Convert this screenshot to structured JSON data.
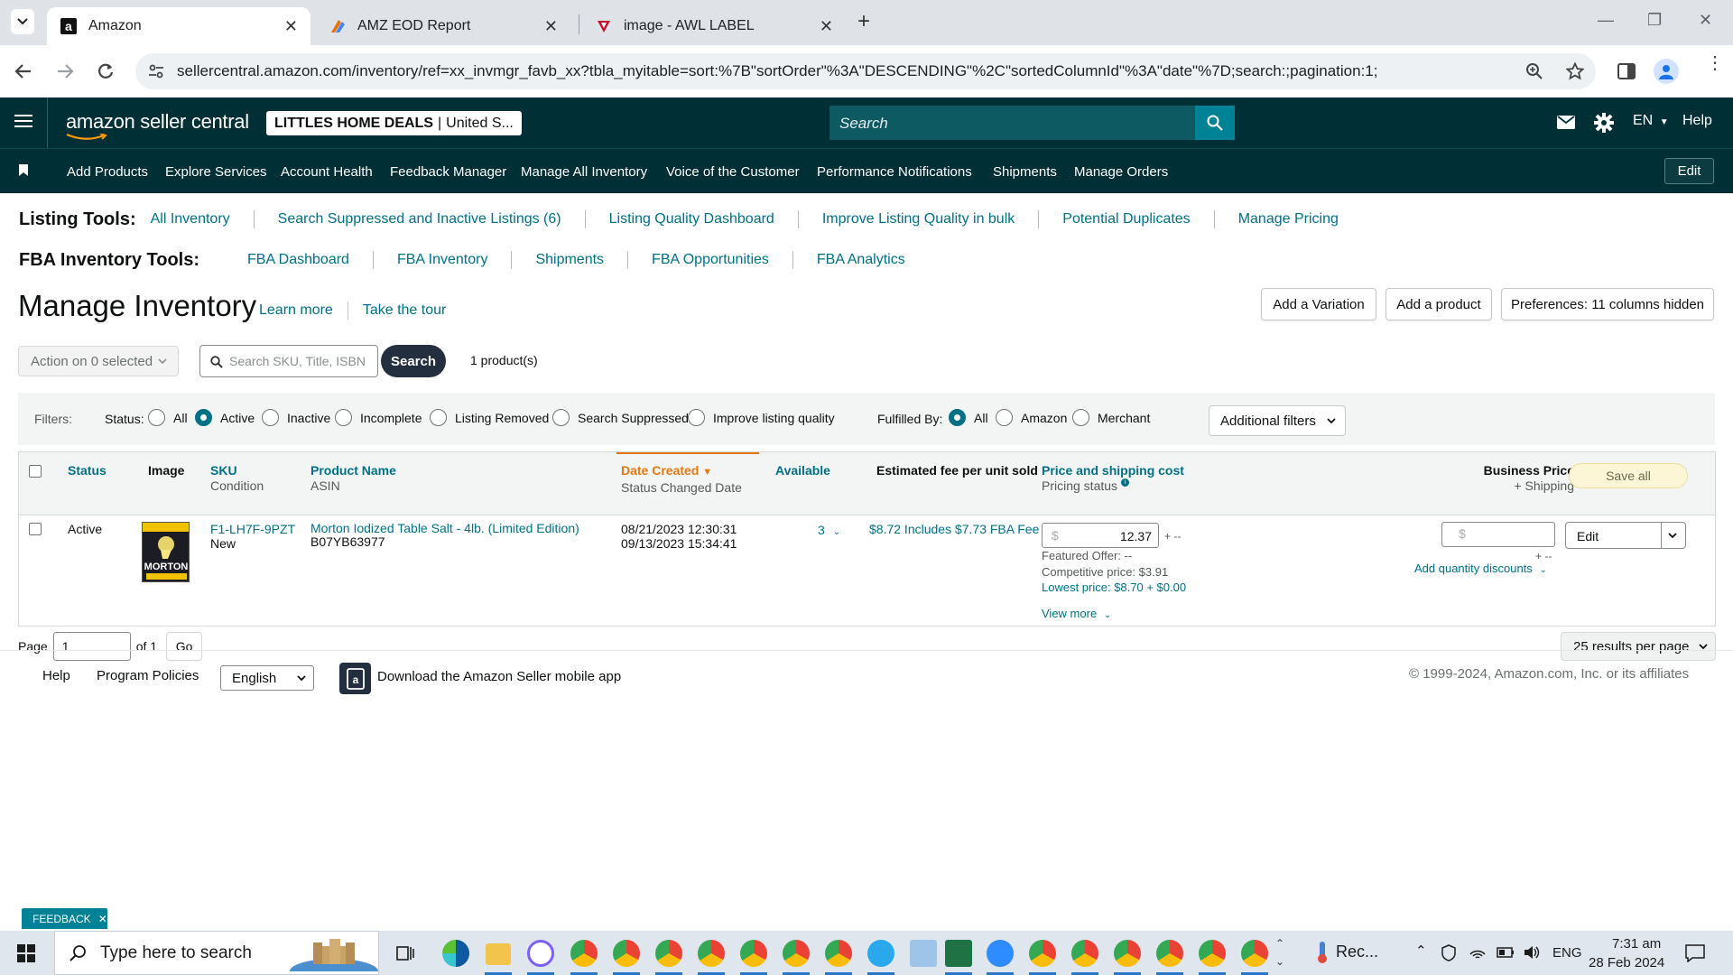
{
  "browser": {
    "tabs": [
      {
        "title": "Amazon",
        "active": true
      },
      {
        "title": "AMZ EOD Report",
        "active": false
      },
      {
        "title": "image - AWL LABEL",
        "active": false
      }
    ],
    "url": "sellercentral.amazon.com/inventory/ref=xx_invmgr_favb_xx?tbla_myitable=sort:%7B\"sortOrder\"%3A\"DESCENDING\"%2C\"sortedColumnId\"%3A\"date\"%7D;search:;pagination:1;"
  },
  "header": {
    "logo": "amazon seller central",
    "store_name": "LITTLES HOME DEALS",
    "store_region": "United S...",
    "search_placeholder": "Search",
    "language": "EN",
    "help": "Help"
  },
  "nav": {
    "items": [
      "Add Products",
      "Explore Services",
      "Account Health",
      "Feedback Manager",
      "Manage All Inventory",
      "Voice of the Customer",
      "Performance Notifications",
      "Shipments",
      "Manage Orders"
    ],
    "edit": "Edit"
  },
  "listing_tools": {
    "title": "Listing Tools:",
    "links": [
      "All Inventory",
      "Search Suppressed and Inactive Listings (6)",
      "Listing Quality Dashboard",
      "Improve Listing Quality in bulk",
      "Potential Duplicates",
      "Manage Pricing"
    ]
  },
  "fba_tools": {
    "title": "FBA Inventory Tools:",
    "links": [
      "FBA Dashboard",
      "FBA Inventory",
      "Shipments",
      "FBA Opportunities",
      "FBA Analytics"
    ]
  },
  "page": {
    "title": "Manage Inventory",
    "learn_more": "Learn more",
    "tour": "Take the tour",
    "add_variation": "Add a Variation",
    "add_product": "Add a product",
    "preferences": "Preferences: 11 columns hidden"
  },
  "actions": {
    "action_select": "Action on 0 selected",
    "search_placeholder": "Search SKU, Title, ISBN",
    "search_btn": "Search",
    "count": "1 product(s)"
  },
  "filters": {
    "label": "Filters:",
    "status_label": "Status:",
    "status_options": [
      "All",
      "Active",
      "Inactive",
      "Incomplete",
      "Listing Removed",
      "Search Suppressed",
      "Improve listing quality"
    ],
    "status_selected": "Active",
    "fulfilled_label": "Fulfilled By:",
    "fulfilled_options": [
      "All",
      "Amazon",
      "Merchant"
    ],
    "fulfilled_selected": "All",
    "additional": "Additional filters"
  },
  "table": {
    "headers": {
      "status": "Status",
      "image": "Image",
      "sku": "SKU",
      "condition": "Condition",
      "product_name": "Product Name",
      "asin": "ASIN",
      "date_created": "Date Created",
      "status_changed": "Status Changed Date",
      "available": "Available",
      "fee": "Estimated fee per unit sold",
      "price": "Price and shipping cost",
      "pricing_status": "Pricing status",
      "business_price": "Business Price",
      "plus_shipping": "+ Shipping",
      "save_all": "Save all"
    },
    "rows": [
      {
        "status": "Active",
        "image_text": "MORTON",
        "sku": "F1-LH7F-9PZT",
        "condition": "New",
        "product_name": "Morton Iodized Table Salt - 4lb. (Limited Edition)",
        "asin": "B07YB63977",
        "date_created": "08/21/2023 12:30:31",
        "status_changed": "09/13/2023 15:34:41",
        "available": "3",
        "fee": "$8.72 Includes $7.73 FBA Fee",
        "currency": "$",
        "price": "12.37",
        "shipping": "+ --",
        "featured_offer": "Featured Offer: --",
        "competitive_price": "Competitive price: $3.91",
        "lowest_price": "Lowest price: $8.70 + $0.00",
        "view_more": "View more",
        "business_currency": "$",
        "business_shipping": "+ --",
        "quantity_discounts": "Add quantity discounts",
        "edit": "Edit"
      }
    ]
  },
  "pager": {
    "page_label": "Page",
    "page": "1",
    "of": "of 1",
    "go": "Go",
    "per_page": "25 results per page"
  },
  "footer": {
    "help": "Help",
    "policies": "Program Policies",
    "language": "English",
    "download_app": "Download the Amazon Seller mobile app",
    "copyright": "© 1999-2024, Amazon.com, Inc. or its affiliates"
  },
  "feedback": "FEEDBACK",
  "taskbar": {
    "search_placeholder": "Type here to search",
    "rec": "Rec...",
    "lang": "ENG",
    "time": "7:31 am",
    "date": "28 Feb 2024"
  },
  "colors": {
    "header_bg": "#002f36",
    "link": "#007185",
    "accent_orange": "#e47911"
  }
}
